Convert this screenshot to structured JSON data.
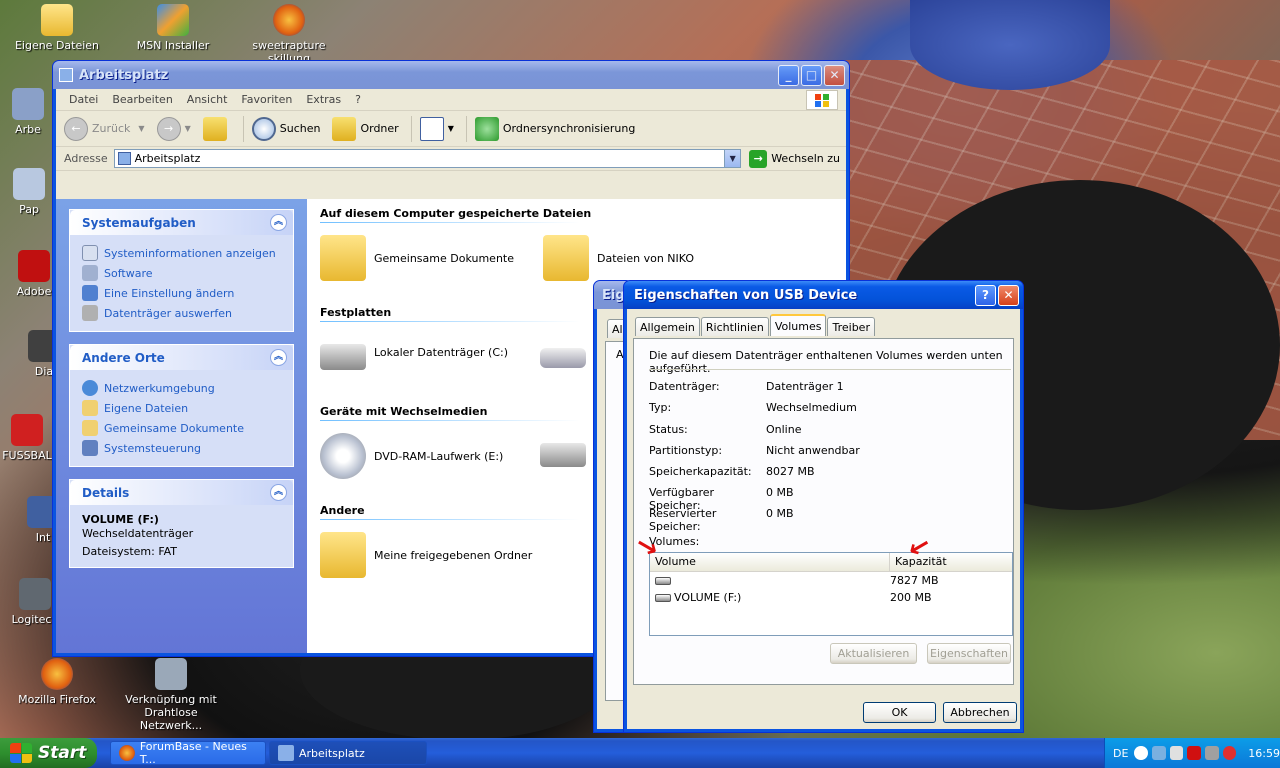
{
  "desktop": {
    "icons": [
      {
        "label": "Eigene Dateien"
      },
      {
        "label": "MSN Installer"
      },
      {
        "label": "sweetrapture skillung"
      },
      {
        "label": "Arbe"
      },
      {
        "label": "Pap"
      },
      {
        "label": "Adobe"
      },
      {
        "label": "Dia"
      },
      {
        "label": "FUSSBAL"
      },
      {
        "label": "Int"
      },
      {
        "label": "Logitech"
      },
      {
        "label": "Mozilla Firefox"
      },
      {
        "label": "Verknüpfung mit Drahtlose Netzwerk..."
      }
    ]
  },
  "explorer": {
    "title": "Arbeitsplatz",
    "menu": [
      "Datei",
      "Bearbeiten",
      "Ansicht",
      "Favoriten",
      "Extras",
      "?"
    ],
    "toolbar": {
      "back": "Zurück",
      "search": "Suchen",
      "folders": "Ordner",
      "sync": "Ordnersynchronisierung"
    },
    "address": {
      "label": "Adresse",
      "value": "Arbeitsplatz",
      "go": "Wechseln zu"
    },
    "system_tasks": {
      "title": "Systemaufgaben",
      "items": [
        "Systeminformationen anzeigen",
        "Software",
        "Eine Einstellung ändern",
        "Datenträger auswerfen"
      ]
    },
    "other_places": {
      "title": "Andere Orte",
      "items": [
        "Netzwerkumgebung",
        "Eigene Dateien",
        "Gemeinsame Dokumente",
        "Systemsteuerung"
      ]
    },
    "details": {
      "title": "Details",
      "name": "VOLUME (F:)",
      "type": "Wechseldatenträger",
      "fs": "Dateisystem: FAT"
    },
    "groups": {
      "stored": "Auf diesem Computer gespeicherte Dateien",
      "drives": "Festplatten",
      "removable": "Geräte mit Wechselmedien",
      "other": "Andere"
    },
    "items": {
      "shared_docs": "Gemeinsame Dokumente",
      "niko": "Dateien von NIKO",
      "local_c": "Lokaler Datenträger (C:)",
      "dvd": "DVD-RAM-Laufwerk (E:)",
      "shared_folders": "Meine freigegebenen Ordner"
    }
  },
  "back_dialog": {
    "title": "Eige",
    "tab": "All",
    "letter": "A"
  },
  "dialog": {
    "title": "Eigenschaften von USB Device",
    "help": "?",
    "tabs": [
      "Allgemein",
      "Richtlinien",
      "Volumes",
      "Treiber"
    ],
    "intro": "Die auf diesem Datenträger enthaltenen Volumes werden unten aufgeführt.",
    "props": [
      {
        "k": "Datenträger:",
        "v": "Datenträger 1"
      },
      {
        "k": "Typ:",
        "v": "Wechselmedium"
      },
      {
        "k": "Status:",
        "v": "Online"
      },
      {
        "k": "Partitionstyp:",
        "v": "Nicht anwendbar"
      },
      {
        "k": "Speicherkapazität:",
        "v": "8027 MB"
      },
      {
        "k": "Verfügbarer Speicher:",
        "v": "0 MB"
      },
      {
        "k": "Reservierter Speicher:",
        "v": "0 MB"
      }
    ],
    "volumes_label": "Volumes:",
    "columns": [
      "Volume",
      "Kapazität"
    ],
    "volumes": [
      {
        "name": "",
        "size": "7827 MB"
      },
      {
        "name": "VOLUME (F:)",
        "size": "200 MB"
      }
    ],
    "refresh": "Aktualisieren",
    "properties": "Eigenschaften",
    "ok": "OK",
    "cancel": "Abbrechen"
  },
  "taskbar": {
    "start": "Start",
    "tasks": [
      "ForumBase - Neues T...",
      "Arbeitsplatz"
    ],
    "lang": "DE",
    "clock": "16:59"
  }
}
